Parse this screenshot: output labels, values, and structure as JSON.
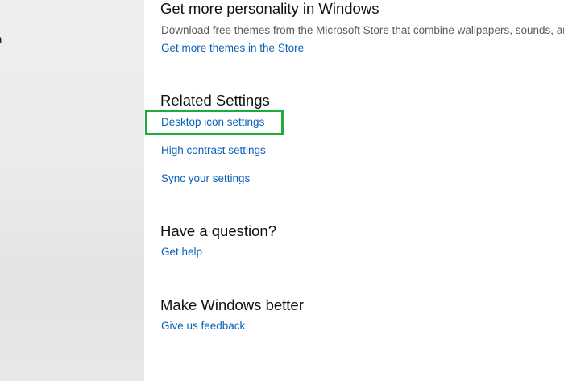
{
  "sidebar": {
    "fragment_text": "n"
  },
  "personality": {
    "heading": "Get more personality in Windows",
    "description": "Download free themes from the Microsoft Store that combine wallpapers, sounds, and",
    "link": "Get more themes in the Store"
  },
  "related": {
    "heading": "Related Settings",
    "links": [
      "Desktop icon settings",
      "High contrast settings",
      "Sync your settings"
    ]
  },
  "question": {
    "heading": "Have a question?",
    "link": "Get help"
  },
  "better": {
    "heading": "Make Windows better",
    "link": "Give us feedback"
  },
  "colors": {
    "link": "#0a62b8",
    "highlight": "#1fac3e"
  }
}
